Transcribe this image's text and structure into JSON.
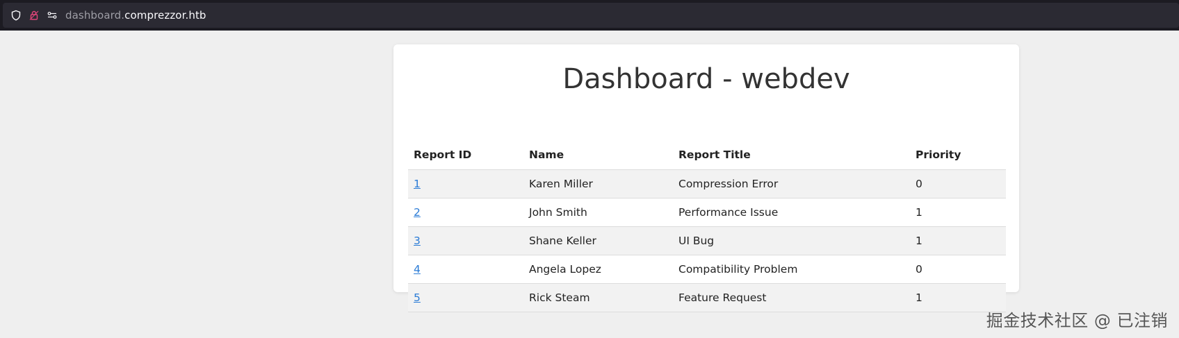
{
  "browser": {
    "url_prefix": "dashboard.",
    "url_domain": "comprezzor.htb",
    "icons": [
      "shield-icon",
      "lock-icon",
      "permissions-icon"
    ]
  },
  "page": {
    "title": "Dashboard - webdev"
  },
  "table": {
    "headers": [
      "Report ID",
      "Name",
      "Report Title",
      "Priority"
    ],
    "rows": [
      {
        "id": "1",
        "name": "Karen Miller",
        "title": "Compression Error",
        "priority": "0"
      },
      {
        "id": "2",
        "name": "John Smith",
        "title": "Performance Issue",
        "priority": "1"
      },
      {
        "id": "3",
        "name": "Shane Keller",
        "title": "UI Bug",
        "priority": "1"
      },
      {
        "id": "4",
        "name": "Angela Lopez",
        "title": "Compatibility Problem",
        "priority": "0"
      },
      {
        "id": "5",
        "name": "Rick Steam",
        "title": "Feature Request",
        "priority": "1"
      }
    ]
  },
  "watermark": "掘金技术社区 @ 已注销",
  "colors": {
    "link": "#2a7bd6",
    "page_bg": "#efefef",
    "toolbar_bg": "#1c1b22"
  }
}
